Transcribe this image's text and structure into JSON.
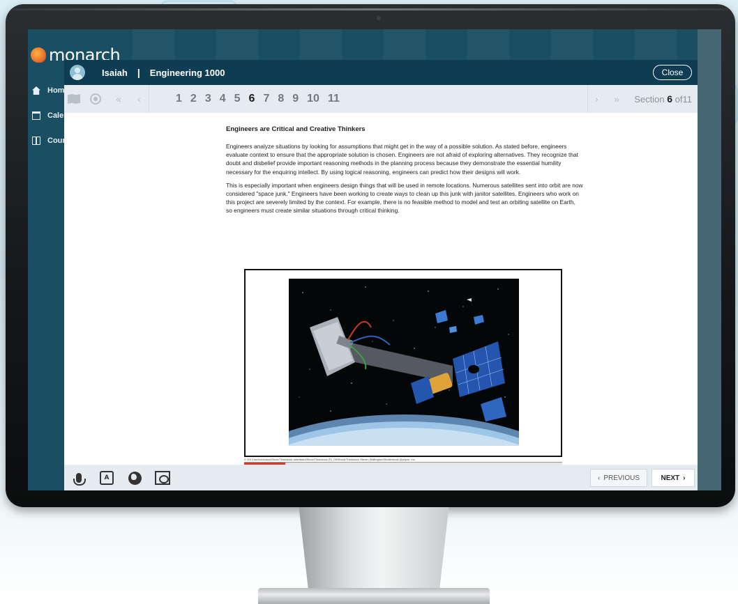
{
  "app": {
    "brand": "monarch"
  },
  "sidebar": {
    "items": [
      {
        "label": "Hom",
        "icon": "home-icon"
      },
      {
        "label": "Cale",
        "icon": "calendar-icon"
      },
      {
        "label": "Cour",
        "icon": "course-icon"
      }
    ]
  },
  "reader": {
    "user": "Isaiah",
    "separator": "|",
    "course": "Engineering 1000",
    "close_label": "Close",
    "nav": {
      "first": "«",
      "prev": "‹",
      "next": "›",
      "last": "»"
    },
    "sections": [
      "1",
      "2",
      "3",
      "4",
      "5",
      "6",
      "7",
      "8",
      "9",
      "10",
      "11"
    ],
    "current_section": "6",
    "section_label": "Section",
    "section_of": "of",
    "section_total": "11"
  },
  "content": {
    "heading": "Engineers are Critical and Creative Thinkers",
    "paragraphs": [
      "Engineers analyze situations by looking for assumptions that might get in the way of a possible solution. As stated before, engineers evaluate context to ensure that the appropriate solution is chosen. Engineers are not afraid of exploring alternatives. They recognize that doubt and disbelief provide important reasoning methods in the planning process because they demonstrate the essential humility necessary for the enquiring intellect. By using logical reasoning, engineers can predict how their designs will work.",
      "This is especially important when engineers design things that will be used in remote locations. Numerous satellites sent into orbit are now considered \"space junk.\" Engineers have been working to create ways to clean up this junk with janitor satellites. Engineers who work on this project are severely limited by the context. For example, there is no feasible method to model and test an orbiting satellite on Earth, so engineers must create similar situations through critical thinking."
    ],
    "figure_credit": "© 2013 tsn/bordeaux/iStock/Thinkstock  arteritadu/iStock/Thinkstock  ZU_09/iStock/Thinkstock  Steven Wallington/Shutterstock  @jolyon, Inc",
    "credit_progress": 0.13
  },
  "bottom_bar": {
    "tools": [
      "microphone-icon",
      "translate-icon",
      "globe-icon",
      "screen-reader-icon"
    ],
    "prev_label": "PREVIOUS",
    "next_label": "NEXT",
    "prev_chevron": "‹",
    "next_chevron": "›"
  },
  "colors": {
    "header_bg": "#0e3d53",
    "toolbar_bg": "#e6ebf0",
    "accent_red": "#d23a2a",
    "app_bg": "#1a4e62"
  }
}
